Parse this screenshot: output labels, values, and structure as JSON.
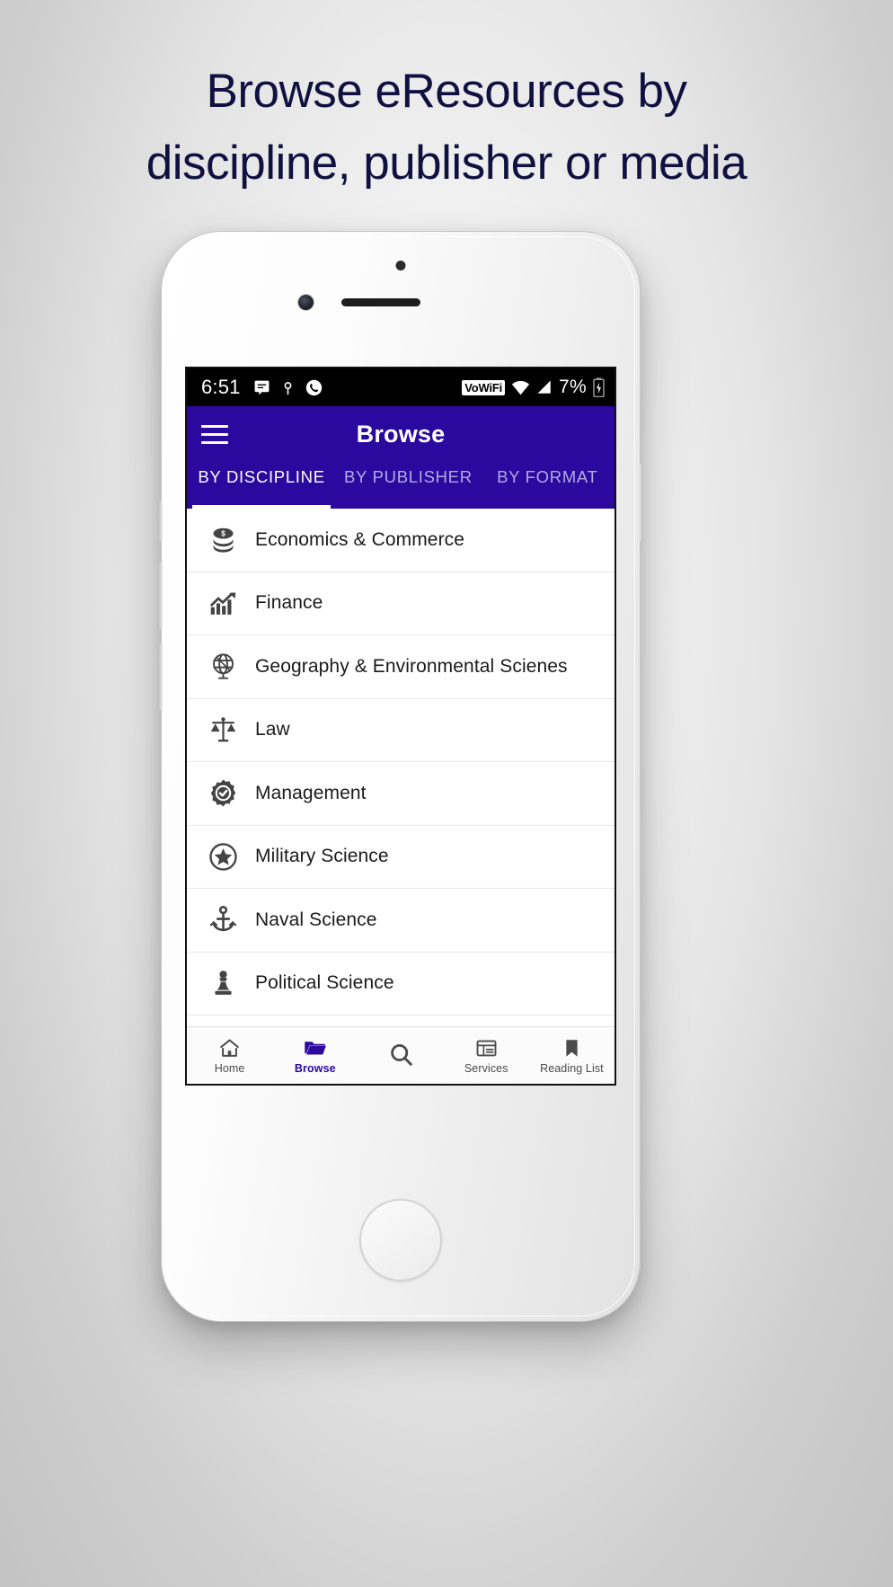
{
  "headline": {
    "line1": "Browse eResources by",
    "line2": "discipline, publisher or media"
  },
  "colors": {
    "brand_purple": "#2B089E",
    "headline": "#111141",
    "status_bar": "#000000",
    "tab_inactive": "#b6abe4"
  },
  "phone": {
    "status_bar": {
      "time": "6:51",
      "left_icons": [
        "message-icon",
        "location-icon",
        "phone-call-icon"
      ],
      "vowifi_badge": "VoWiFi",
      "right_icons": [
        "wifi-icon",
        "signal-icon",
        "charging-battery-icon"
      ],
      "battery_text": "7%"
    },
    "app_bar": {
      "menu_icon": "hamburger-menu-icon",
      "title": "Browse"
    },
    "tabs": [
      {
        "label": "BY DISCIPLINE",
        "active": true
      },
      {
        "label": "BY PUBLISHER",
        "active": false
      },
      {
        "label": "BY FORMAT",
        "active": false
      }
    ],
    "disciplines": [
      {
        "label": "Economics & Commerce",
        "icon": "coins-stack-icon"
      },
      {
        "label": "Finance",
        "icon": "trending-chart-icon"
      },
      {
        "label": "Geography & Environmental Scienes",
        "icon": "globe-icon"
      },
      {
        "label": "Law",
        "icon": "scales-of-justice-icon"
      },
      {
        "label": "Management",
        "icon": "verified-badge-icon"
      },
      {
        "label": "Military Science",
        "icon": "star-circle-icon"
      },
      {
        "label": "Naval Science",
        "icon": "anchor-icon"
      },
      {
        "label": "Political Science",
        "icon": "chess-pawn-icon"
      }
    ],
    "bottom_nav": [
      {
        "label": "Home",
        "icon": "home-icon",
        "active": false
      },
      {
        "label": "Browse",
        "icon": "folder-icon",
        "active": true
      },
      {
        "label": "",
        "icon": "search-icon",
        "active": false
      },
      {
        "label": "Services",
        "icon": "services-list-icon",
        "active": false
      },
      {
        "label": "Reading List",
        "icon": "bookmark-icon",
        "active": false
      }
    ]
  }
}
